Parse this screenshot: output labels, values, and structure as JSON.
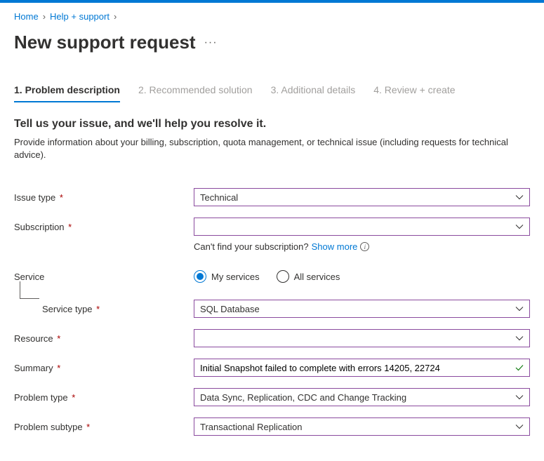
{
  "breadcrumb": {
    "home": "Home",
    "help": "Help + support"
  },
  "page_title": "New support request",
  "tabs": {
    "t1": "1. Problem description",
    "t2": "2. Recommended solution",
    "t3": "3. Additional details",
    "t4": "4. Review + create"
  },
  "subtitle": "Tell us your issue, and we'll help you resolve it.",
  "description": "Provide information about your billing, subscription, quota management, or technical issue (including requests for technical advice).",
  "labels": {
    "issue_type": "Issue type",
    "subscription": "Subscription",
    "service": "Service",
    "service_type": "Service type",
    "resource": "Resource",
    "summary": "Summary",
    "problem_type": "Problem type",
    "problem_subtype": "Problem subtype"
  },
  "values": {
    "issue_type": "Technical",
    "subscription": "",
    "service_type": "SQL Database",
    "resource": "",
    "summary": "Initial Snapshot failed to complete with errors 14205, 22724",
    "problem_type": "Data Sync, Replication, CDC and Change Tracking",
    "problem_subtype": "Transactional Replication"
  },
  "hint": {
    "text": "Can't find your subscription?",
    "link": "Show more"
  },
  "radio": {
    "my_services": "My services",
    "all_services": "All services"
  }
}
